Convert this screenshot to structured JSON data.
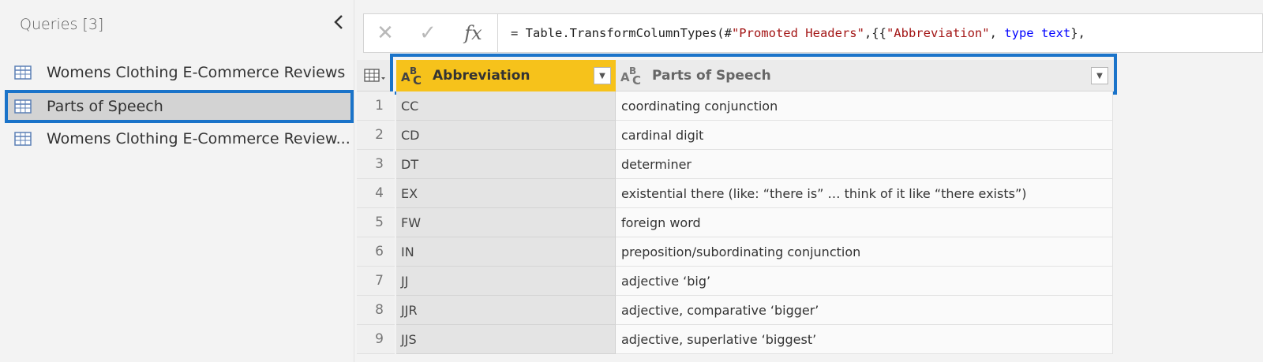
{
  "queries": {
    "title": "Queries [3]",
    "collapse_icon": "chevron-left-icon",
    "items": [
      {
        "label": "Womens Clothing E-Commerce Reviews",
        "selected": false
      },
      {
        "label": "Parts of Speech",
        "selected": true
      },
      {
        "label": "Womens Clothing E-Commerce Review..."
      }
    ]
  },
  "formula_bar": {
    "cancel_icon": "✕",
    "commit_icon": "✓",
    "fx_label": "fx",
    "formula_prefix": "= Table.TransformColumnTypes(#",
    "formula_str1": "\"Promoted Headers\"",
    "formula_mid": ",{{",
    "formula_str2": "\"Abbreviation\"",
    "formula_sep": ", ",
    "formula_kw": "type text",
    "formula_end": "},"
  },
  "table": {
    "columns": [
      {
        "name": "Abbreviation",
        "type_icon": "text-type-icon",
        "selected": true
      },
      {
        "name": "Parts of Speech",
        "type_icon": "text-type-icon",
        "selected": false
      }
    ],
    "rows": [
      {
        "n": "1",
        "abbr": "CC",
        "pos": "coordinating conjunction"
      },
      {
        "n": "2",
        "abbr": "CD",
        "pos": "cardinal digit"
      },
      {
        "n": "3",
        "abbr": "DT",
        "pos": "determiner"
      },
      {
        "n": "4",
        "abbr": "EX",
        "pos": "existential there (like: “there is” … think of it like “there exists”)"
      },
      {
        "n": "5",
        "abbr": "FW",
        "pos": "foreign word"
      },
      {
        "n": "6",
        "abbr": "IN",
        "pos": "preposition/subordinating conjunction"
      },
      {
        "n": "7",
        "abbr": "JJ",
        "pos": "adjective ‘big’"
      },
      {
        "n": "8",
        "abbr": "JJR",
        "pos": "adjective, comparative ‘bigger’"
      },
      {
        "n": "9",
        "abbr": "JJS",
        "pos": "adjective, superlative ‘biggest’"
      }
    ]
  },
  "colors": {
    "selection_outline": "#1a73c9",
    "selected_header": "#f6c21b"
  }
}
